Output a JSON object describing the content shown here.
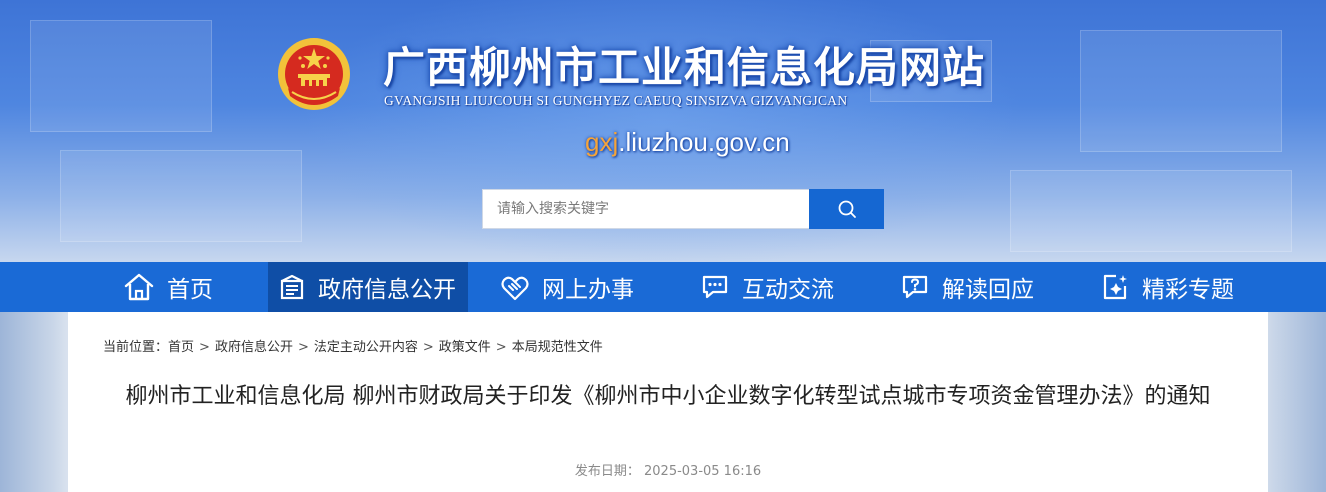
{
  "header": {
    "title": "广西柳州市工业和信息化局网站",
    "subtitle": "GVANGJSIH LIUJCOUH SI GUNGHYEZ CAEUQ SINSIZVA GIZVANGJCAN",
    "domain_highlight": "gxj",
    "domain_rest": ".liuzhou.gov.cn",
    "emblem_icon": "national-emblem-icon"
  },
  "search": {
    "placeholder": "请输入搜索关键字",
    "button_icon": "search-icon"
  },
  "nav": {
    "items": [
      {
        "label": "首页",
        "icon": "home-icon",
        "active": false
      },
      {
        "label": "政府信息公开",
        "icon": "document-icon",
        "active": true
      },
      {
        "label": "网上办事",
        "icon": "handshake-icon",
        "active": false
      },
      {
        "label": "互动交流",
        "icon": "chat-icon",
        "active": false
      },
      {
        "label": "解读回应",
        "icon": "question-chat-icon",
        "active": false
      },
      {
        "label": "精彩专题",
        "icon": "sparkle-icon",
        "active": false
      }
    ]
  },
  "breadcrumb": {
    "prefix": "当前位置：",
    "items": [
      "首页",
      "政府信息公开",
      "法定主动公开内容",
      "政策文件",
      "本局规范性文件"
    ],
    "separator": ">"
  },
  "article": {
    "title": "柳州市工业和信息化局 柳州市财政局关于印发《柳州市中小企业数字化转型试点城市专项资金管理办法》的通知",
    "publish_label": "发布日期：",
    "publish_date": "2025-03-05 16:16"
  },
  "colors": {
    "nav_bg": "#1a6ad6",
    "nav_active": "#0f4ea6",
    "search_button": "#1567d2",
    "domain_highlight": "#f5a43a"
  }
}
